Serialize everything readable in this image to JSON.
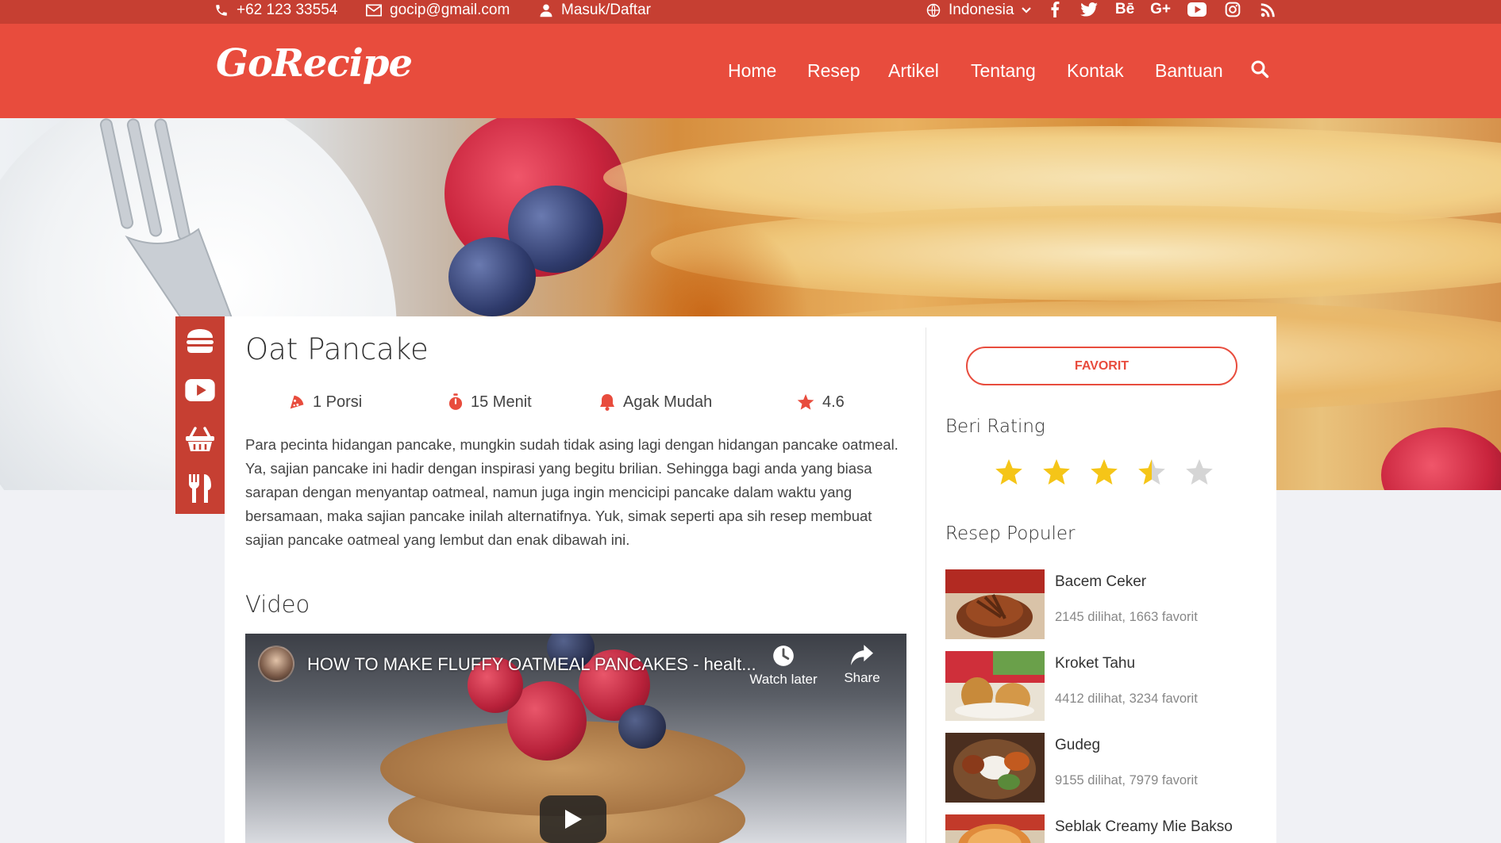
{
  "topbar": {
    "phone": "+62 123 33554",
    "email": "gocip@gmail.com",
    "account": "Masuk/Daftar",
    "language": "Indonesia",
    "social_icons": [
      "facebook-icon",
      "twitter-icon",
      "behance-icon",
      "google-plus-icon",
      "youtube-icon",
      "instagram-icon",
      "rss-icon"
    ],
    "social_labels": {
      "behance": "Bē",
      "googleplus": "G+"
    }
  },
  "nav": {
    "logo": "GoRecipe",
    "items": [
      "Home",
      "Resep",
      "Artikel",
      "Tentang",
      "Kontak",
      "Bantuan"
    ]
  },
  "sidebar_icons": [
    "burger-icon",
    "youtube-icon",
    "basket-icon",
    "utensils-icon"
  ],
  "recipe": {
    "title": "Oat Pancake",
    "portion": "1 Porsi",
    "time": "15 Menit",
    "difficulty": "Agak Mudah",
    "rating": "4.6",
    "description": "Para pecinta hidangan pancake, mungkin sudah tidak asing lagi dengan hidangan pancake oatmeal. Ya, sajian pancake ini hadir dengan inspirasi yang begitu brilian. Sehingga bagi anda yang biasa sarapan dengan menyantap oatmeal, namun juga ingin mencicipi pancake dalam waktu yang bersamaan, maka sajian pancake inilah alternatifnya. Yuk, simak seperti apa sih resep membuat sajian pancake oatmeal yang lembut dan enak dibawah ini."
  },
  "video": {
    "heading": "Video",
    "title": "HOW TO MAKE FLUFFY OATMEAL PANCAKES - healt...",
    "watch_later": "Watch later",
    "share": "Share"
  },
  "side": {
    "favorite_button": "FAVORIT",
    "rating_heading": "Beri Rating",
    "rating_value": 3.5,
    "rating_max": 5,
    "popular_heading": "Resep Populer",
    "popular": [
      {
        "name": "Bacem Ceker",
        "stats": "2145 dilihat, 1663 favorit"
      },
      {
        "name": "Kroket Tahu",
        "stats": "4412 dilihat, 3234 favorit"
      },
      {
        "name": "Gudeg",
        "stats": "9155 dilihat, 7979 favorit"
      },
      {
        "name": "Seblak Creamy Mie Bakso",
        "stats": ""
      }
    ]
  },
  "colors": {
    "primary": "#e84c3d",
    "topbar": "#c63f32",
    "star": "#f5c518",
    "star_empty": "#d5d5d5"
  }
}
